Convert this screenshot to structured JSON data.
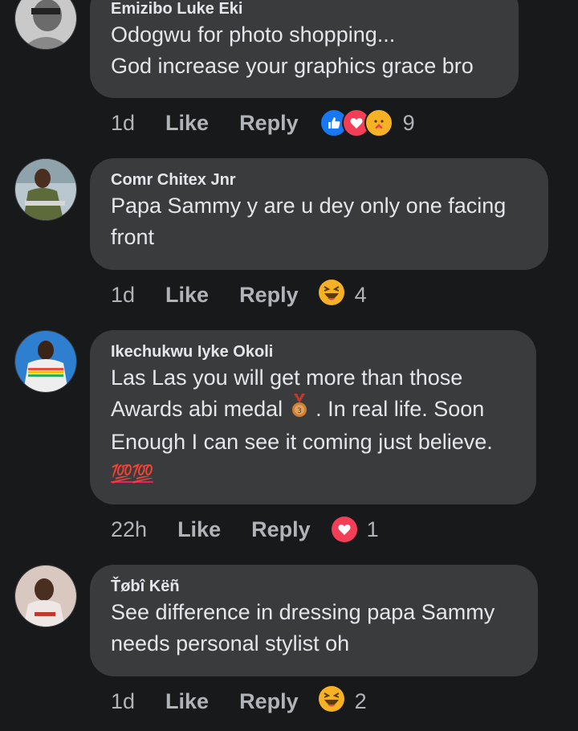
{
  "comments": [
    {
      "author": "Emizibo Luke Eki",
      "lines": [
        "Odogwu for photo shopping...",
        "God increase your graphics grace bro"
      ],
      "time": "1d",
      "like_label": "Like",
      "reply_label": "Reply",
      "reactions": [
        "like",
        "love",
        "care"
      ],
      "reaction_count": "9"
    },
    {
      "author": "Comr Chitex Jnr",
      "lines": [
        "Papa Sammy y are u dey only one facing",
        "front"
      ],
      "time": "1d",
      "like_label": "Like",
      "reply_label": "Reply",
      "reactions": [
        "haha"
      ],
      "reaction_count": "4"
    },
    {
      "author": "Ikechukwu Iyke Okoli",
      "lines": [
        "Las Las you will get more than those",
        "Awards abi medal",
        ". In real life. Soon",
        "Enough I can see it coming just believe."
      ],
      "emoji_line": "💯💯",
      "time": "22h",
      "like_label": "Like",
      "reply_label": "Reply",
      "reactions": [
        "love"
      ],
      "reaction_count": "1"
    },
    {
      "author": "Ťøbî Këñ",
      "lines": [
        "See difference in dressing papa Sammy",
        "needs personal stylist oh"
      ],
      "time": "1d",
      "like_label": "Like",
      "reply_label": "Reply",
      "reactions": [
        "haha"
      ],
      "reaction_count": "2"
    }
  ],
  "colors": {
    "background": "#18191a",
    "bubble": "#3a3b3c",
    "text": "#e4e6eb",
    "meta": "#b0b3b8",
    "like": "#1877f2",
    "love": "#f33e58",
    "haha": "#f7b125"
  }
}
